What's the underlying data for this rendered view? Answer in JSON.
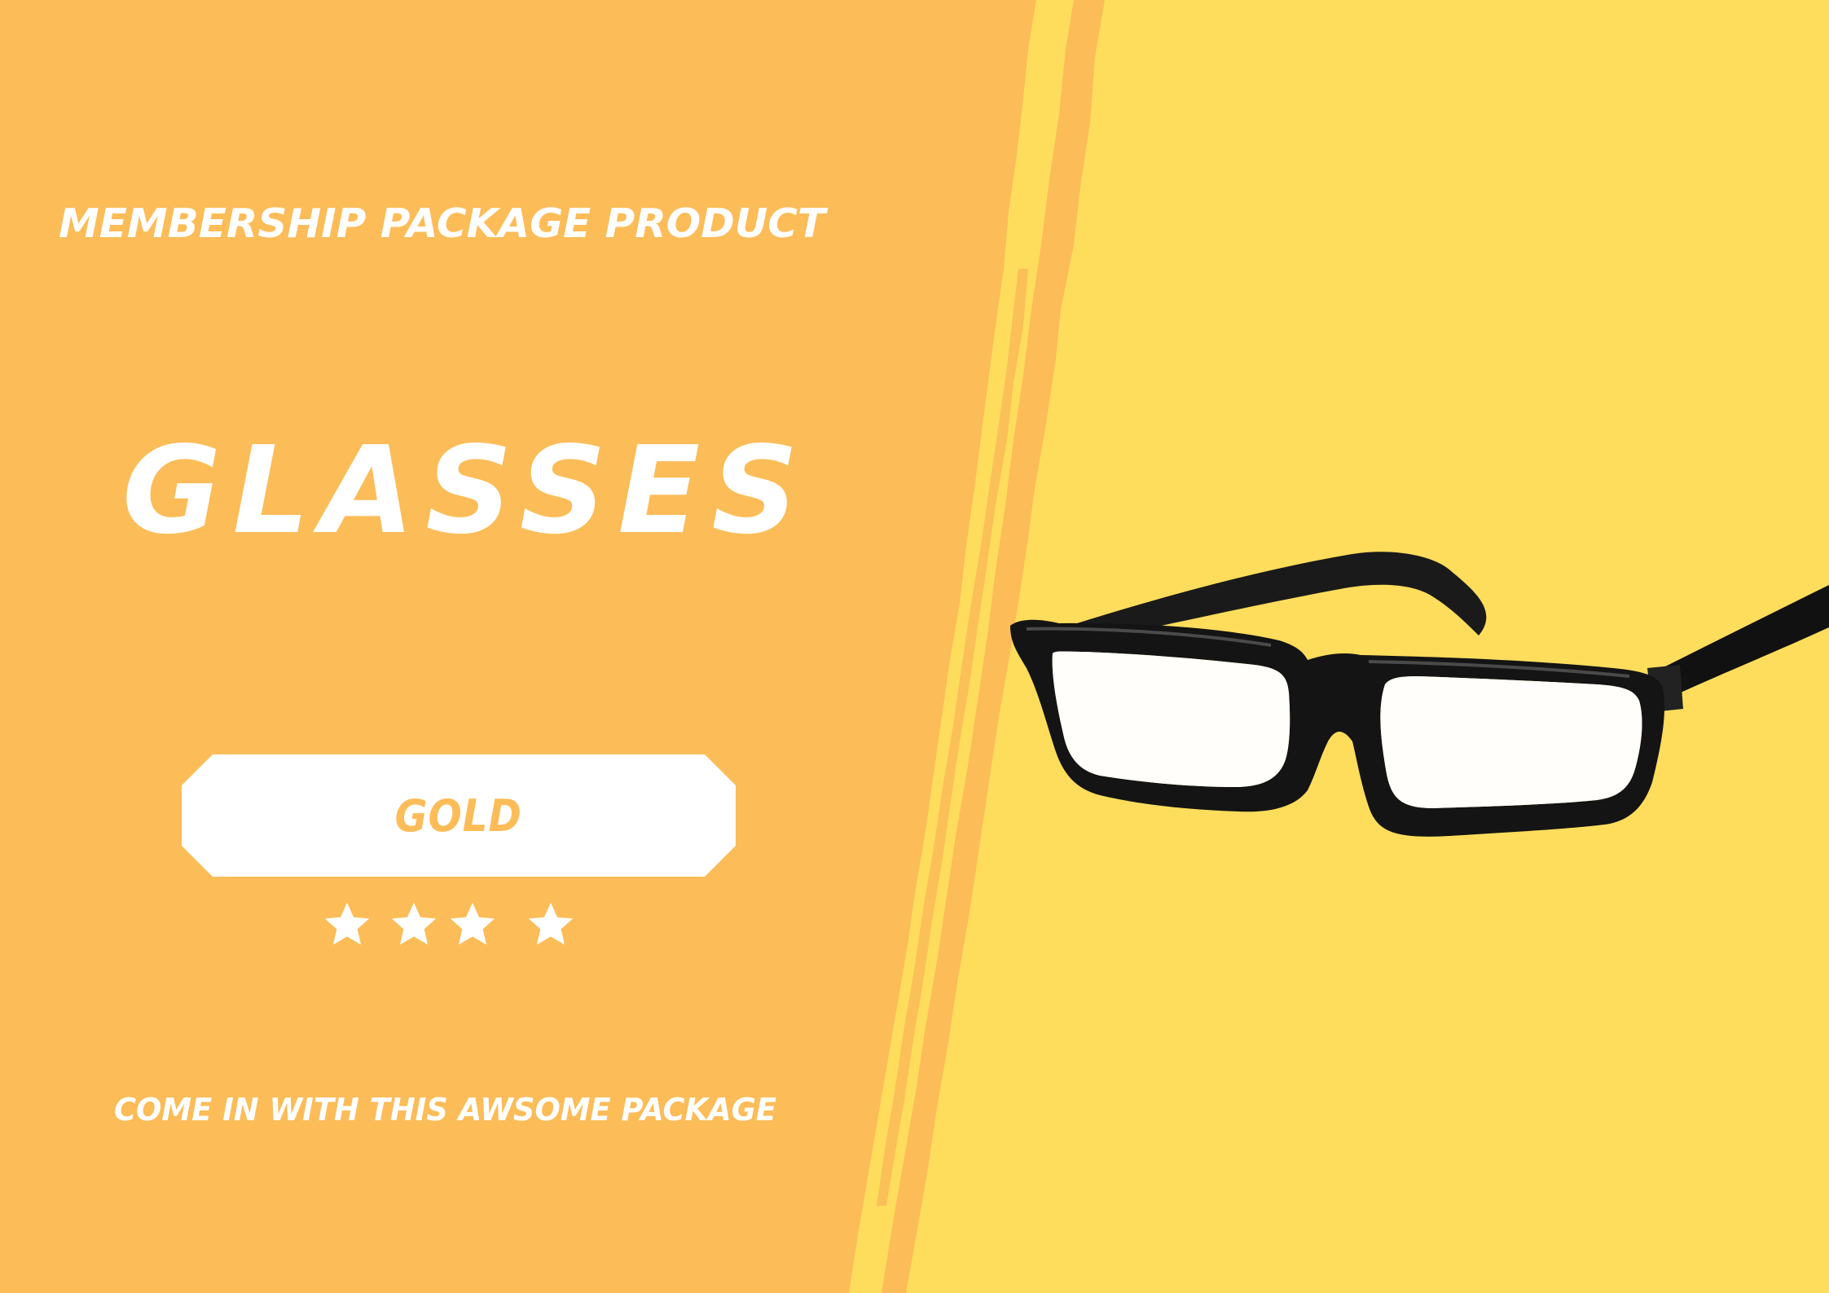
{
  "colors": {
    "left_panel": "#FCBC58",
    "right_panel": "#FFDD5C",
    "text": "#FFFFFF",
    "frame": "#111111"
  },
  "header": {
    "subtitle": "MEMBERSHIP PACKAGE PRODUCT",
    "title": "GLASSES"
  },
  "package": {
    "tier_label": "GOLD",
    "rating": 4,
    "rating_max": 4
  },
  "footer": {
    "tagline": "COME IN WITH THIS AWSOME PACKAGE"
  },
  "product_image": {
    "icon": "eyeglasses-icon"
  }
}
